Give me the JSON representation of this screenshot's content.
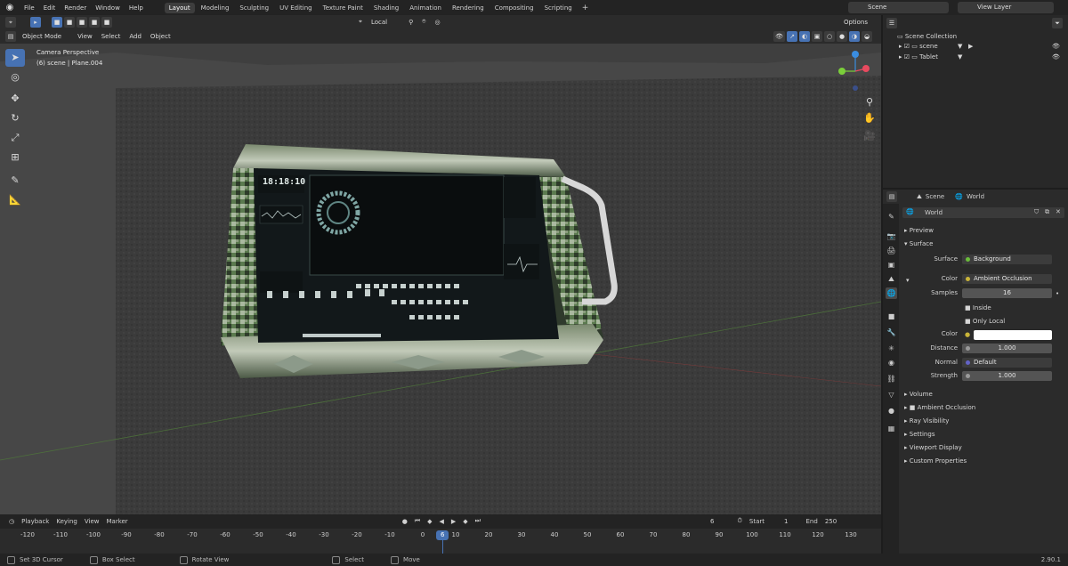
{
  "menu": [
    "File",
    "Edit",
    "Render",
    "Window",
    "Help"
  ],
  "workspaces": [
    "Layout",
    "Modeling",
    "Sculpting",
    "UV Editing",
    "Texture Paint",
    "Shading",
    "Animation",
    "Rendering",
    "Compositing",
    "Scripting"
  ],
  "active_workspace": "Layout",
  "scene_field": "Scene",
  "view_layer_field": "View Layer",
  "viewport_header": {
    "transform_orientation": "Local",
    "options": "Options",
    "mode": "Object Mode",
    "view": "View",
    "select": "Select",
    "add": "Add",
    "object": "Object"
  },
  "viewport": {
    "perspective_label": "Camera Perspective",
    "object_info": "(6) scene | Plane.004"
  },
  "tablet_screen": {
    "clock": "18:18:10"
  },
  "timeline": {
    "playback": "Playback",
    "keying": "Keying",
    "view": "View",
    "marker": "Marker",
    "current_frame": "6",
    "start_label": "Start",
    "start": "1",
    "end_label": "End",
    "end": "250",
    "ticks": [
      "-120",
      "-110",
      "-100",
      "-90",
      "-80",
      "-70",
      "-60",
      "-50",
      "-40",
      "-30",
      "-20",
      "-10",
      "0",
      "10",
      "20",
      "30",
      "40",
      "50",
      "60",
      "70",
      "80",
      "90",
      "100",
      "110",
      "120",
      "130"
    ],
    "marker_value": "6"
  },
  "status": {
    "item1": "Set 3D Cursor",
    "item2": "Box Select",
    "item3": "Rotate View",
    "item4": "Select",
    "item5": "Move",
    "version": "2.90.1"
  },
  "outliner": {
    "collection": "Scene Collection",
    "rows": [
      "scene",
      "Tablet"
    ]
  },
  "properties": {
    "breadcrumb_scene": "Scene",
    "breadcrumb_world": "World",
    "world_name": "World",
    "preview": "Preview",
    "surface": "Surface",
    "surface_label": "Surface",
    "surface_value": "Background",
    "color_label": "Color",
    "color_value": "Ambient Occlusion",
    "samples_label": "Samples",
    "samples_value": "16",
    "inside": "Inside",
    "only_local": "Only Local",
    "color2_label": "Color",
    "color2_value": "#ffffff",
    "distance_label": "Distance",
    "distance_value": "1.000",
    "normal_label": "Normal",
    "normal_value": "Default",
    "strength_label": "Strength",
    "strength_value": "1.000",
    "volume": "Volume",
    "ambient_occlusion": "Ambient Occlusion",
    "ray_visibility": "Ray Visibility",
    "settings": "Settings",
    "viewport_display": "Viewport Display",
    "custom_properties": "Custom Properties"
  },
  "colors": {
    "accent": "#4772b3",
    "x_axis": "#e84a5f",
    "y_axis": "#7bcf3a",
    "z_axis": "#3a8de0"
  }
}
